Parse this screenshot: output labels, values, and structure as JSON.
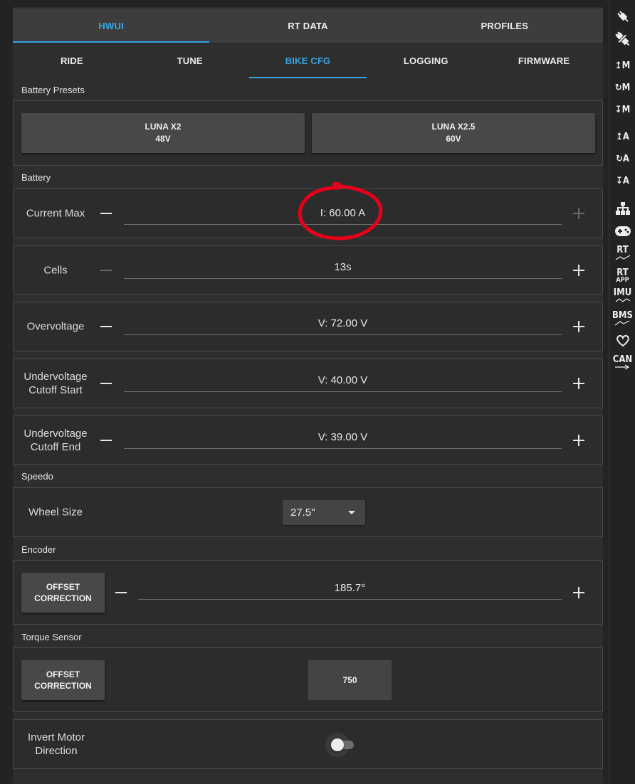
{
  "tabs_top": [
    "HWUI",
    "RT DATA",
    "PROFILES"
  ],
  "tabs_sub": [
    "RIDE",
    "TUNE",
    "BIKE CFG",
    "LOGGING",
    "FIRMWARE"
  ],
  "battery_presets": {
    "label": "Battery Presets",
    "buttons": [
      {
        "line1": "LUNA X2",
        "line2": "48V"
      },
      {
        "line1": "LUNA X2.5",
        "line2": "60V"
      }
    ]
  },
  "battery": {
    "label": "Battery",
    "rows": [
      {
        "label": "Current Max",
        "value": "I: 60.00 A"
      },
      {
        "label": "Cells",
        "value": "13s"
      },
      {
        "label": "Overvoltage",
        "value": "V: 72.00 V"
      },
      {
        "label": "Undervoltage Cutoff Start",
        "value": "V: 40.00 V"
      },
      {
        "label": "Undervoltage Cutoff End",
        "value": "V: 39.00 V"
      }
    ]
  },
  "speedo": {
    "label": "Speedo",
    "wheel_size_label": "Wheel Size",
    "wheel_size_value": "27.5\""
  },
  "encoder": {
    "label": "Encoder",
    "offset_line1": "OFFSET",
    "offset_line2": "CORRECTION",
    "value": "185.7°"
  },
  "torque_sensor": {
    "label": "Torque Sensor",
    "offset_line1": "OFFSET",
    "offset_line2": "CORRECTION",
    "value": "750"
  },
  "invert_motor": {
    "label": "Invert Motor Direction",
    "enabled": false
  },
  "rightbar": {
    "icons": [
      "connect-plug-icon",
      "disconnect-plug-icon",
      "read-motor-config-icon",
      "read-default-motor-config-icon",
      "write-motor-config-icon",
      "read-app-config-icon",
      "read-default-app-config-icon",
      "write-app-config-icon",
      "can-network-icon",
      "gamepad-icon",
      "rt-data-icon",
      "rt-app-data-icon",
      "imu-icon",
      "bms-icon",
      "heart-icon",
      "can-fwd-icon"
    ],
    "labels": {
      "m": "M",
      "a": "A",
      "rt": "RT",
      "app": "APP",
      "imu": "IMU",
      "bms": "BMS",
      "can": "CAN"
    }
  },
  "colors": {
    "accent": "#35a6e8",
    "annotation": "#e8001a"
  }
}
